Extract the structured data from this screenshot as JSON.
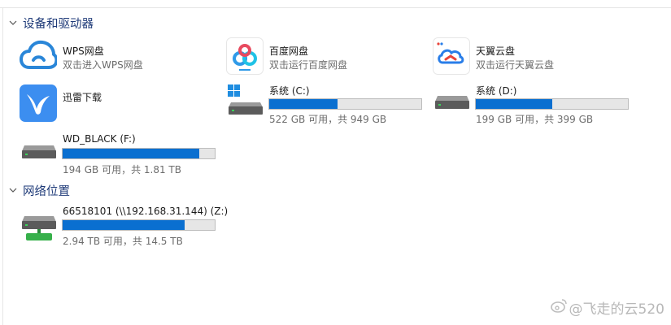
{
  "groups": {
    "devices": {
      "title": "设备和驱动器"
    },
    "network": {
      "title": "网络位置"
    }
  },
  "items": {
    "wps": {
      "name": "WPS网盘",
      "sub": "双击进入WPS网盘"
    },
    "baidu": {
      "name": "百度网盘",
      "sub": "双击运行百度网盘"
    },
    "tianyi": {
      "name": "天翼云盘",
      "sub": "双击运行天翼云盘"
    },
    "xunlei": {
      "name": "迅雷下载"
    },
    "c_drive": {
      "name": "系统 (C:)",
      "sub": "522 GB 可用，共 949 GB",
      "used_fraction": 0.45
    },
    "d_drive": {
      "name": "系统 (D:)",
      "sub": "199 GB 可用，共 399 GB",
      "used_fraction": 0.5
    },
    "f_drive": {
      "name": "WD_BLACK (F:)",
      "sub": "194 GB 可用，共 1.81 TB",
      "used_fraction": 0.9
    },
    "z_drive": {
      "name": "66518101 (\\\\192.168.31.144) (Z:)",
      "sub": "2.94 TB 可用，共 14.5 TB",
      "used_fraction": 0.8
    }
  },
  "colors": {
    "accent": "#0a6fd0",
    "header": "#1e3a78",
    "wps_blue": "#2a86d8",
    "xunlei_blue": "#3c8ef0"
  },
  "watermark": {
    "text": "@飞走的云520"
  }
}
